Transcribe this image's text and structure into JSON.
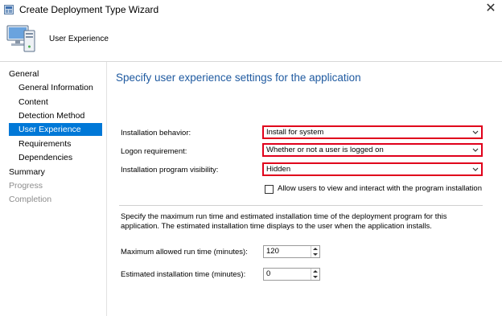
{
  "window": {
    "title": "Create Deployment Type Wizard",
    "close_glyph": "✕"
  },
  "header": {
    "page_name": "User Experience"
  },
  "nav": {
    "items": [
      {
        "label": "General",
        "level": "top",
        "state": "normal"
      },
      {
        "label": "General Information",
        "level": "sub",
        "state": "normal"
      },
      {
        "label": "Content",
        "level": "sub",
        "state": "normal"
      },
      {
        "label": "Detection Method",
        "level": "sub",
        "state": "normal"
      },
      {
        "label": "User Experience",
        "level": "sub",
        "state": "selected"
      },
      {
        "label": "Requirements",
        "level": "sub",
        "state": "normal"
      },
      {
        "label": "Dependencies",
        "level": "sub",
        "state": "normal"
      },
      {
        "label": "Summary",
        "level": "top",
        "state": "normal"
      },
      {
        "label": "Progress",
        "level": "top",
        "state": "disabled"
      },
      {
        "label": "Completion",
        "level": "top",
        "state": "disabled"
      }
    ]
  },
  "main": {
    "heading": "Specify user experience settings for the application",
    "installation_behavior": {
      "label": "Installation behavior:",
      "value": "Install for system"
    },
    "logon_requirement": {
      "label": "Logon requirement:",
      "value": "Whether or not a user is logged on"
    },
    "program_visibility": {
      "label": "Installation program visibility:",
      "value": "Hidden"
    },
    "allow_interact": {
      "label": "Allow users to view and interact with the program installation",
      "checked": false
    },
    "runtime_description": "Specify the maximum run time and estimated installation time of the deployment program for this application. The estimated installation time displays to the user when the application installs.",
    "max_run_time": {
      "label": "Maximum allowed run time (minutes):",
      "value": "120"
    },
    "estimated_time": {
      "label": "Estimated installation time (minutes):",
      "value": "0"
    }
  },
  "colors": {
    "heading": "#1f5aa0",
    "highlight_border": "#e0001b",
    "nav_selected": "#0078d7"
  },
  "icons": {
    "app": "wizard-app-icon",
    "header": "computer-icon",
    "dropdown": "chevron-down-icon",
    "spin_up": "arrow-up-icon",
    "spin_down": "arrow-down-icon"
  }
}
